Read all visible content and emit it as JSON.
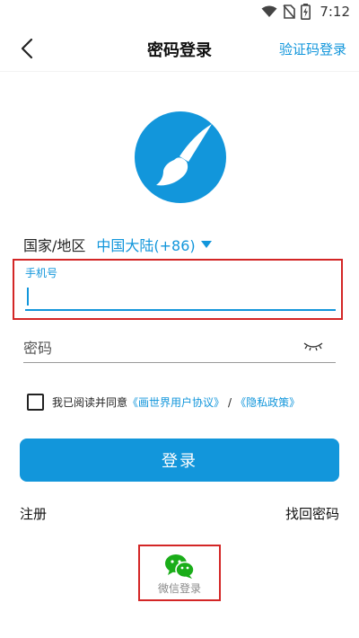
{
  "status_bar": {
    "time": "7:12"
  },
  "header": {
    "title": "密码登录",
    "switch_mode": "验证码登录"
  },
  "form": {
    "country_label": "国家/地区",
    "country_value": "中国大陆(+86)",
    "phone_label": "手机号",
    "phone_value": "",
    "password_placeholder": "密码",
    "agreement": {
      "prefix": "我已阅读并同意",
      "user_agreement": "《画世界用户协议》",
      "separator": "/",
      "privacy_policy": "《隐私政策》",
      "checked": false
    },
    "login_button": "登录",
    "register": "注册",
    "forgot_password": "找回密码"
  },
  "wechat": {
    "label": "微信登录"
  },
  "colors": {
    "accent": "#1296db",
    "wechat": "#1aad19",
    "highlight_box": "#d32626"
  }
}
